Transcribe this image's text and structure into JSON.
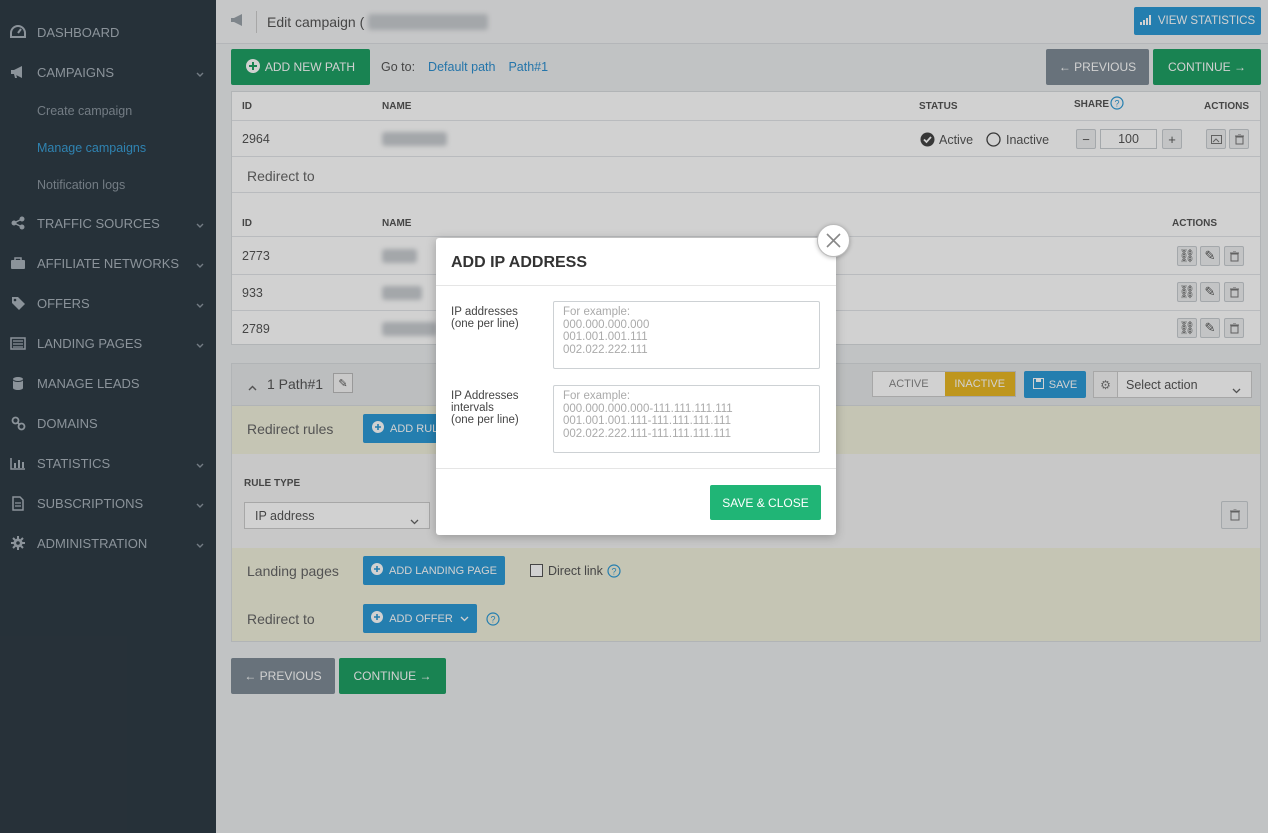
{
  "sidebar": {
    "items": [
      {
        "label": "DASHBOARD",
        "icon": "dashboard-icon"
      },
      {
        "label": "CAMPAIGNS",
        "icon": "megaphone-icon",
        "expanded": true
      },
      {
        "label": "TRAFFIC SOURCES",
        "icon": "share-icon"
      },
      {
        "label": "AFFILIATE NETWORKS",
        "icon": "briefcase-icon"
      },
      {
        "label": "OFFERS",
        "icon": "tag-icon"
      },
      {
        "label": "LANDING PAGES",
        "icon": "list-icon"
      },
      {
        "label": "MANAGE LEADS",
        "icon": "database-icon"
      },
      {
        "label": "DOMAINS",
        "icon": "link-icon"
      },
      {
        "label": "STATISTICS",
        "icon": "bar-chart-icon"
      },
      {
        "label": "SUBSCRIPTIONS",
        "icon": "document-icon"
      },
      {
        "label": "ADMINISTRATION",
        "icon": "gear-icon"
      }
    ],
    "subitems": [
      "Create campaign",
      "Manage campaigns",
      "Notification logs"
    ]
  },
  "header": {
    "title": "Edit campaign (",
    "view_stats": "VIEW STATISTICS"
  },
  "toolbar": {
    "add_path": "ADD NEW PATH",
    "goto": "Go to:",
    "link1": "Default path",
    "link2": "Path#1",
    "previous": "← PREVIOUS",
    "continue": "CONTINUE →"
  },
  "table1": {
    "headers": {
      "id": "ID",
      "name": "NAME",
      "status": "STATUS",
      "share": "SHARE",
      "actions": "ACTIONS"
    },
    "row": {
      "id": "2964",
      "active": "Active",
      "inactive": "Inactive",
      "share": "100"
    },
    "redirect_to": "Redirect to"
  },
  "table2": {
    "headers": {
      "id": "ID",
      "name": "NAME",
      "actions": "ACTIONS"
    },
    "rows": [
      "2773",
      "933",
      "2789"
    ]
  },
  "path": {
    "title": "1 Path#1",
    "active": "ACTIVE",
    "inactive": "INACTIVE",
    "save": "SAVE",
    "select_action": "Select action",
    "redirect_rules": "Redirect rules",
    "add_rule": "ADD RULE",
    "rule_type": "RULE TYPE",
    "rule_value": "IP address",
    "landing_pages": "Landing pages",
    "add_landing": "ADD LANDING PAGE",
    "direct_link": "Direct link",
    "redirect_to": "Redirect to",
    "add_offer": "ADD OFFER"
  },
  "bottom": {
    "previous": "← PREVIOUS",
    "continue": "CONTINUE →"
  },
  "modal": {
    "title": "ADD IP ADDRESS",
    "label1": "IP addresses\n(one per line)",
    "placeholder1": "For example:\n000.000.000.000\n001.001.001.111\n002.022.222.111",
    "label2": "IP Addresses\nintervals\n(one per line)",
    "placeholder2": "For example:\n000.000.000.000-111.111.111.111\n001.001.001.111-111.111.111.111\n002.022.222.111-111.111.111.111",
    "save_close": "SAVE & CLOSE"
  },
  "colors": {
    "sidebar": "#2f3c46",
    "accent_blue": "#2d9ad6",
    "green": "#1fa064",
    "inactive_yellow": "#e8b824",
    "path_bg": "#f1f1dc"
  }
}
